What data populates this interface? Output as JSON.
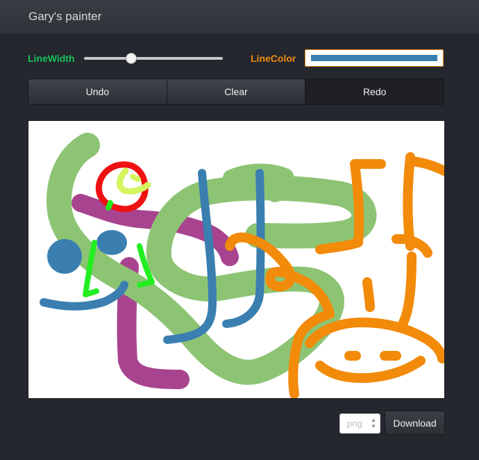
{
  "app": {
    "title": "Gary's painter"
  },
  "controls": {
    "line_width_label": "LineWidth",
    "line_width_fraction": 0.34,
    "line_color_label": "LineColor",
    "line_color_value": "#3a7fb0"
  },
  "toolbar": {
    "undo_label": "Undo",
    "clear_label": "Clear",
    "redo_label": "Redo"
  },
  "colors": {
    "green": "#8dc474",
    "purple": "#a8448f",
    "blue": "#3a7fb0",
    "orange": "#f28a0a",
    "red": "#ee1111",
    "yellow": "#d4f560",
    "bright_green": "#22ee22",
    "width_label": "#17c25a",
    "color_label": "#f08a14"
  },
  "download": {
    "format_value": "png",
    "download_label": "Download"
  }
}
